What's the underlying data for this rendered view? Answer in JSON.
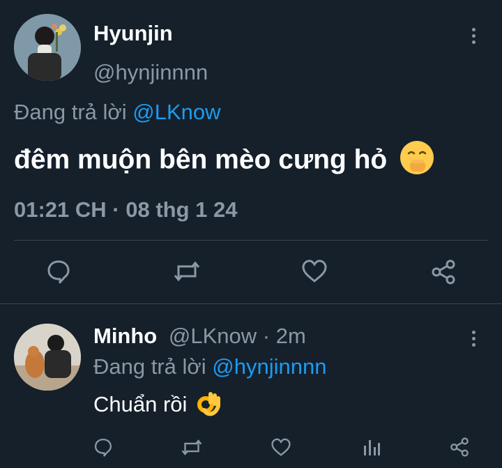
{
  "main_tweet": {
    "author_name": "Hyunjin",
    "author_handle": "@hynjinnnn",
    "reply_prefix": "Đang trả lời",
    "reply_to": "@LKnow",
    "text": "đêm muộn bên mèo cưng hỏ",
    "emoji_icon": "hand-over-mouth-emoji",
    "timestamp": "01:21 CH · 08 thg 1 24"
  },
  "reply_tweet": {
    "author_name": "Minho",
    "author_handle": "@LKnow",
    "time_ago": "· 2m",
    "reply_prefix": "Đang trả lời",
    "reply_to": "@hynjinnnn",
    "text": "Chuẩn rồi",
    "emoji_icon": "ok-hand-emoji"
  },
  "colors": {
    "background": "#15202b",
    "muted": "#8b98a5",
    "accent": "#1d9bf0",
    "divider": "#38444d"
  }
}
